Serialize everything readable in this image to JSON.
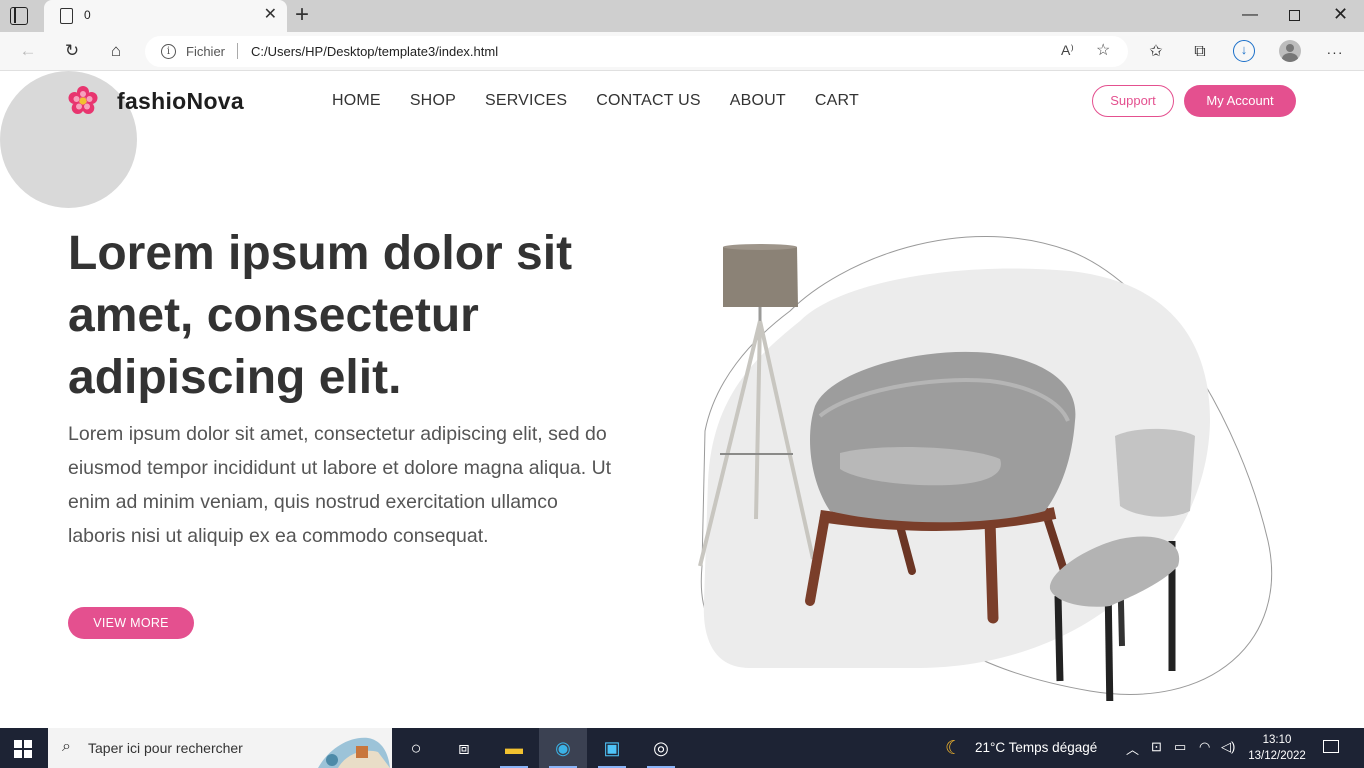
{
  "browser": {
    "tab_title": "0",
    "tab_close": "✕",
    "new_tab": "+",
    "address_label": "Fichier",
    "url": "C:/Users/HP/Desktop/template3/index.html",
    "read_aloud": "A⁾"
  },
  "site": {
    "brand": "fashioNova",
    "nav": [
      "HOME",
      "SHOP",
      "SERVICES",
      "CONTACT US",
      "ABOUT",
      "CART"
    ],
    "support_label": "Support",
    "account_label": "My Account",
    "accent_color": "#e4508f"
  },
  "hero": {
    "title": "Lorem ipsum dolor sit amet, consectetur adipiscing elit.",
    "text": "Lorem ipsum dolor sit amet, consectetur adipiscing elit, sed do eiusmod tempor incididunt ut labore et dolore magna aliqua. Ut enim ad minim veniam, quis nostrud exercitation ullamco laboris nisi ut aliquip ex ea commodo consequat.",
    "button": "VIEW MORE"
  },
  "taskbar": {
    "search_placeholder": "Taper ici pour rechercher",
    "weather": "21°C  Temps dégagé",
    "time": "13:10",
    "date": "13/12/2022"
  }
}
